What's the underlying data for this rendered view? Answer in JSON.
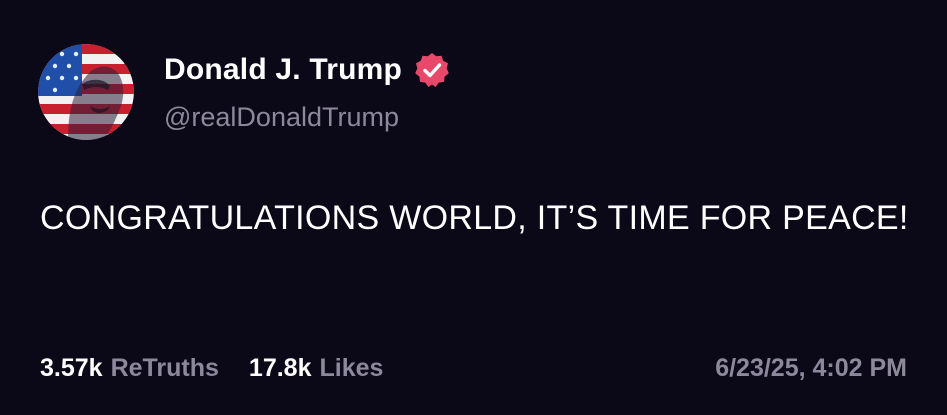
{
  "post": {
    "author": {
      "display_name": "Donald J. Trump",
      "handle": "@realDonaldTrump",
      "verified_icon": "verified-badge-icon",
      "verified_color": "#e8486a",
      "avatar_icon": "flag-portrait-avatar"
    },
    "text": "CONGRATULATIONS WORLD, IT’S TIME FOR PEACE!",
    "stats": {
      "retruths_count": "3.57k",
      "retruths_label": "ReTruths",
      "likes_count": "17.8k",
      "likes_label": "Likes"
    },
    "timestamp": "6/23/25, 4:02 PM"
  },
  "colors": {
    "background": "#0b0818",
    "primary_text": "#ffffff",
    "secondary_text": "#8d889c"
  }
}
